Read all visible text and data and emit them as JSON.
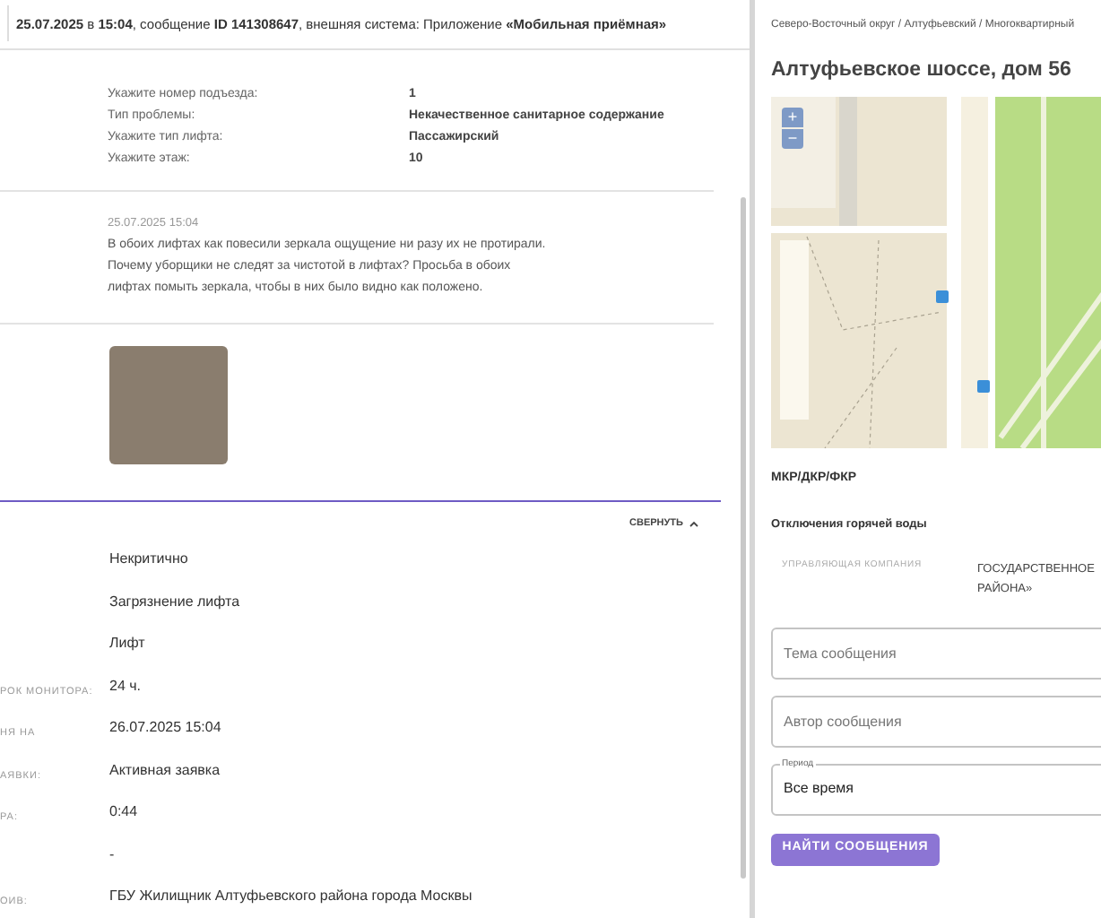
{
  "header": {
    "text": "**25.07.2025** в **15:04**, сообщение **ID 141308647**, внешняя система: Приложение **«Мобильная приёмная»**"
  },
  "answers": [
    {
      "label": "Укажите номер подъезда:",
      "value": "1"
    },
    {
      "label": "Тип проблемы:",
      "value": "Некачественное санитарное содержание"
    },
    {
      "label": "Укажите тип лифта:",
      "value": "Пассажирский"
    },
    {
      "label": "Укажите этаж:",
      "value": "10"
    }
  ],
  "message": {
    "date": "25.07.2025 15:04",
    "text": "В обоих лифтах как повесили зеркала ощущение ни разу их не протирали. Почему уборщики не следят за чистотой в лифтах? Просьба в обоих лифтах помыть зеркала, чтобы в них было видно как положено."
  },
  "collapse": {
    "label": "СВЕРНУТЬ",
    "expanded": true
  },
  "details": [
    {
      "value": "Некритично"
    },
    {
      "value": "Загрязнение лифта"
    },
    {
      "value": "Лифт"
    },
    {
      "label": "РОК МОНИТОРА:",
      "value": "24 ч."
    },
    {
      "label": "НЯ НА",
      "value": "26.07.2025 15:04"
    },
    {
      "label": "АЯВКИ:",
      "value": "Активная заявка"
    },
    {
      "label": "РА:",
      "value": "0:44"
    },
    {
      "value": "-"
    },
    {
      "label": "ОИВ:",
      "value": "ГБУ Жилищник Алтуфьевского района города Москвы"
    }
  ],
  "sidebar": {
    "breadcrumb": "Северо-Восточный округ / Алтуфьевский / Многоквартирный",
    "title": "Алтуфьевское шоссе, дом 56",
    "map": {
      "zoom_in": "+",
      "zoom_out": "−"
    },
    "program": "МКР/ДКР/ФКР",
    "hot_water": "Отключения горячей воды",
    "company": {
      "label": "УПРАВЛЯЮЩАЯ КОМПАНИЯ",
      "value": "ГОСУДАРСТВЕННОЕ РАЙОНА»"
    },
    "fields": [
      {
        "placeholder": "Тема сообщения"
      },
      {
        "placeholder": "Автор сообщения"
      }
    ],
    "period": {
      "label": "Период",
      "value": "Все время"
    },
    "button": "НАЙТИ СООБЩЕНИЯ"
  }
}
